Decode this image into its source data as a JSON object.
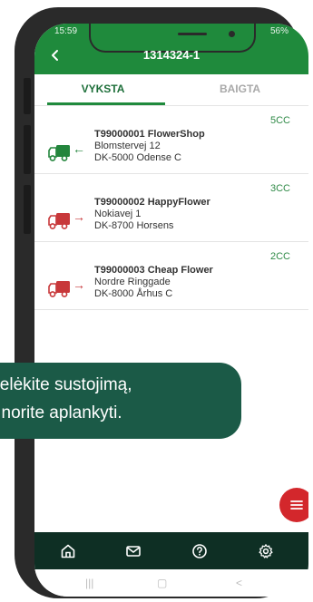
{
  "status_bar": {
    "time": "15:59",
    "signal": "56%"
  },
  "header": {
    "title": "1314324-1"
  },
  "tabs": [
    {
      "label": "VYKSTA"
    },
    {
      "label": "BAIGTA"
    }
  ],
  "stops": [
    {
      "count": "5CC",
      "name": "T99000001 FlowerShop",
      "street": "Blomstervej 12",
      "city": "DK-5000 Odense C",
      "arrow": "←",
      "truck_color": "#23853c"
    },
    {
      "count": "3CC",
      "name": "T99000002 HappyFlower",
      "street": "Nokiavej 1",
      "city": "DK-8700 Horsens",
      "arrow": "→",
      "truck_color": "#c8383a"
    },
    {
      "count": "2CC",
      "name": "T99000003 Cheap Flower",
      "street": "Nordre Ringgade",
      "city": "DK-8000 Århus C",
      "arrow": "→",
      "truck_color": "#c8383a"
    }
  ],
  "tooltip": {
    "line1": "stelėkite sustojimą,",
    "line2": "į norite aplankyti."
  },
  "icons": {
    "back": "chevron-left-icon",
    "home": "home-icon",
    "mail": "mail-icon",
    "help": "help-icon",
    "settings": "gear-icon",
    "menu": "menu-icon",
    "truck": "truck-icon"
  },
  "colors": {
    "brand": "#1f8a3c",
    "nav": "#0e2f24",
    "bubble": "#1b5a47",
    "fab": "#d3272c"
  }
}
